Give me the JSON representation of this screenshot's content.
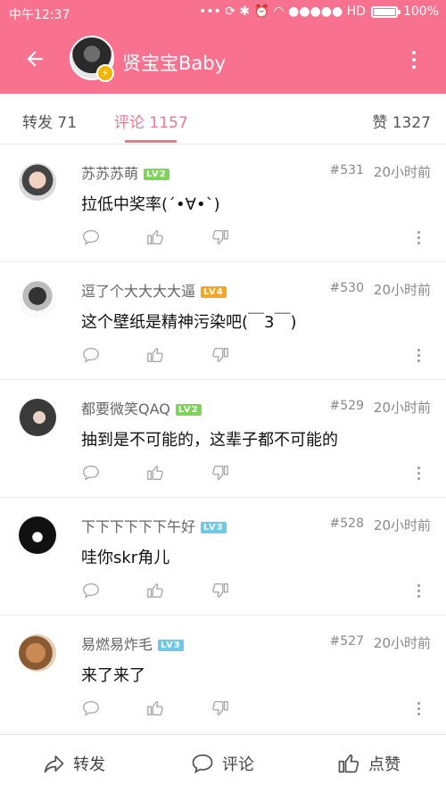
{
  "status_bar": {
    "time": "中午12:37",
    "icons_text": "••• ⟳ ✱ ⏰ ◠ ●●●●● HD",
    "battery": "100%"
  },
  "header": {
    "title": "贤宝宝Baby",
    "badge_icon": "lightning-icon"
  },
  "tabs": {
    "repost": "转发 71",
    "comment": "评论 1157",
    "like": "赞 1327"
  },
  "comments": [
    {
      "user": "苏苏苏萌",
      "level": "LV2",
      "level_color": "#7ed35a",
      "floor": "#531",
      "time": "20小时前",
      "text": "拉低中奖率(´•∀•`)"
    },
    {
      "user": "逗了个大大大大逼",
      "level": "LV4",
      "level_color": "#f6a623",
      "floor": "#530",
      "time": "20小时前",
      "text": "这个壁纸是精神污染吧(￣3￣)"
    },
    {
      "user": "都要微笑QAQ",
      "level": "LV2",
      "level_color": "#7ed35a",
      "floor": "#529",
      "time": "20小时前",
      "text": "抽到是不可能的，这辈子都不可能的"
    },
    {
      "user": "下下下下下下午好",
      "level": "LV3",
      "level_color": "#6ec9e9",
      "floor": "#528",
      "time": "20小时前",
      "text": "哇你skr角儿"
    },
    {
      "user": "易燃易炸毛",
      "level": "LV3",
      "level_color": "#6ec9e9",
      "floor": "#527",
      "time": "20小时前",
      "text": "来了来了"
    }
  ],
  "bottom_bar": {
    "repost": "转发",
    "comment": "评论",
    "like": "点赞"
  },
  "colors": {
    "accent": "#f8728f"
  }
}
